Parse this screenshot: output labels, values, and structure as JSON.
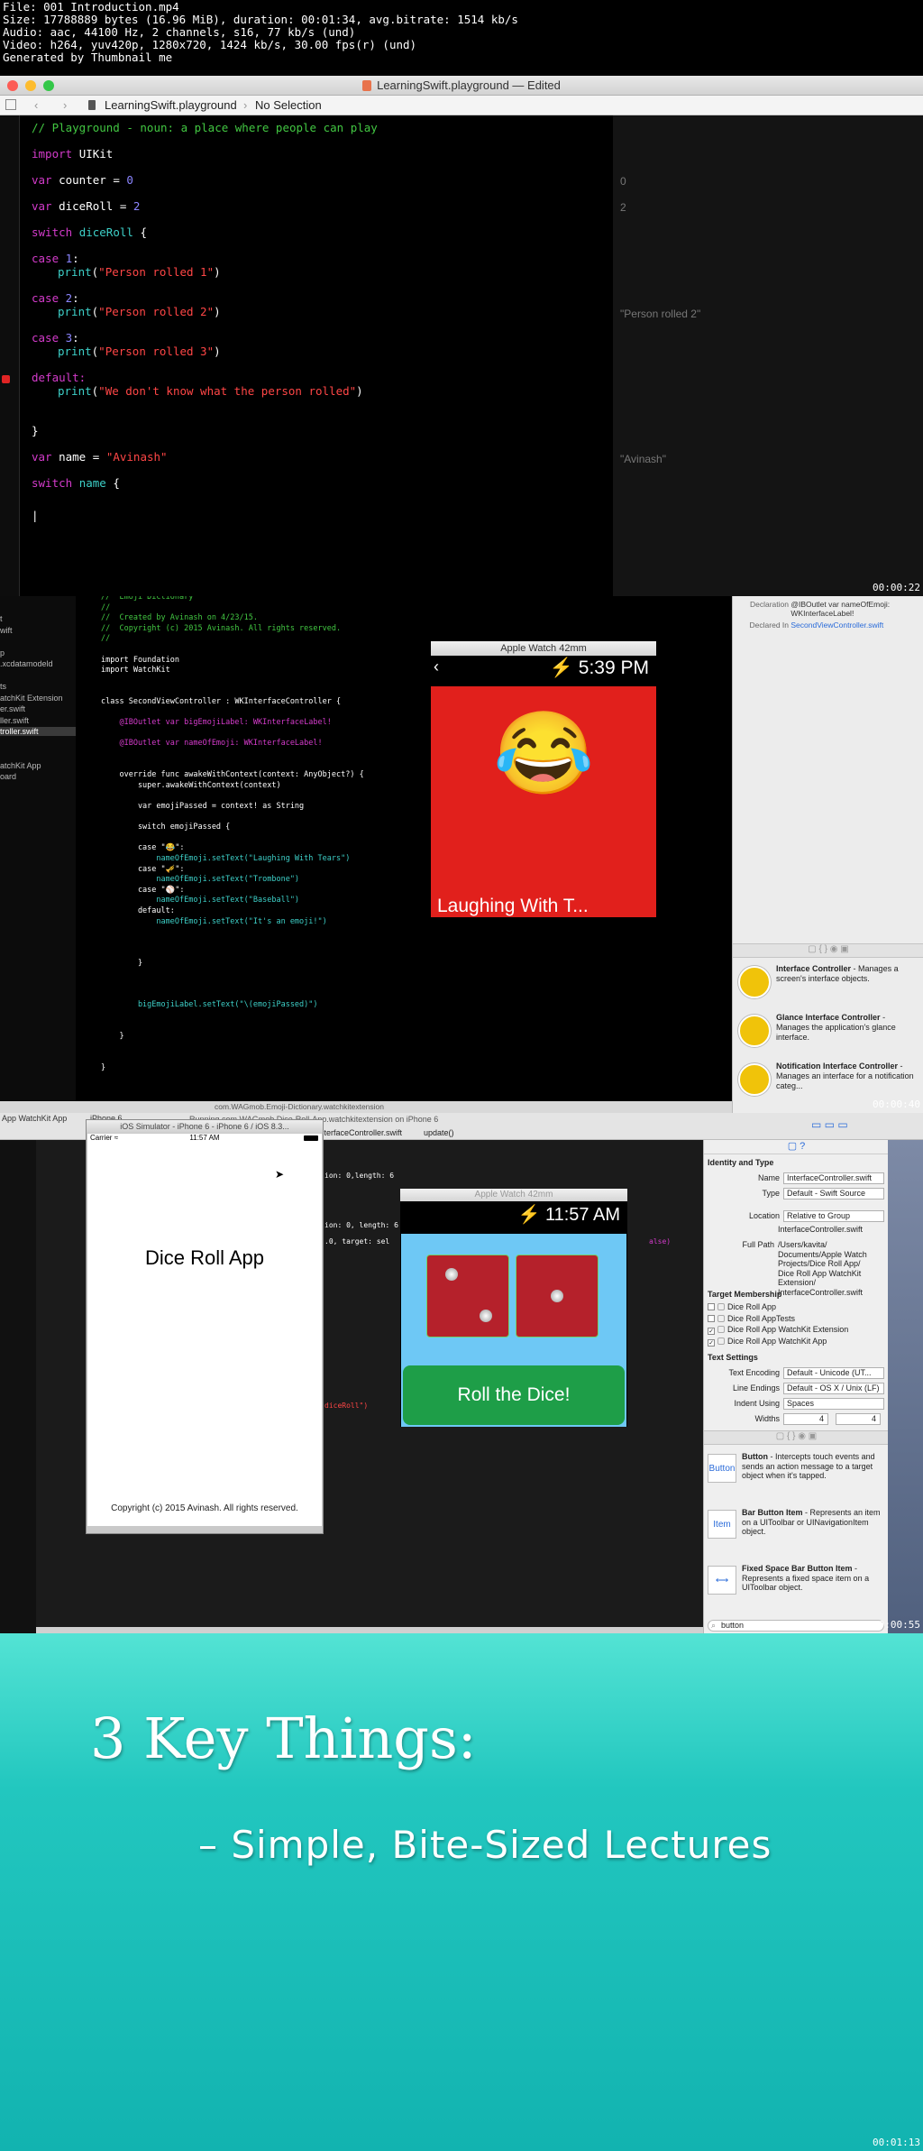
{
  "file_info": [
    "File: 001 Introduction.mp4",
    "Size: 17788889 bytes (16.96 MiB), duration: 00:01:34, avg.bitrate: 1514 kb/s",
    "Audio: aac, 44100 Hz, 2 channels, s16, 77 kb/s (und)",
    "Video: h264, yuv420p, 1280x720, 1424 kb/s, 30.00 fps(r) (und)",
    "Generated by Thumbnail me"
  ],
  "frame1": {
    "window_title": "LearningSwift.playground — Edited",
    "breadcrumb_file": "LearningSwift.playground",
    "breadcrumb_selection": "No Selection",
    "timestamp": "00:00:22",
    "code": {
      "comment": "// Playground - noun: a place where people can play",
      "import_kw": "import",
      "import_mod": "UIKit",
      "var_kw": "var",
      "counter": "counter",
      "counter_val": "0",
      "diceroll": "diceRoll",
      "diceroll_val": "2",
      "switch_kw": "switch",
      "case_kw": "case",
      "case1": "1",
      "case2": "2",
      "case3": "3",
      "print_fn": "print",
      "p1": "\"Person rolled 1\"",
      "p2": "\"Person rolled 2\"",
      "p3": "\"Person rolled 3\"",
      "default_kw": "default:",
      "p4": "\"We don't know what the person rolled\"",
      "name": "name",
      "name_val": "\"Avinash\"",
      "brace_open": "{",
      "brace_close": "}",
      "eq": "=",
      "colon": ":"
    },
    "results": {
      "counter": "0",
      "diceroll": "2",
      "printed": "\"Person rolled 2\"",
      "name": "\"Avinash\""
    }
  },
  "frame2": {
    "timestamp": "00:00:40",
    "watch_title": "Apple Watch 42mm",
    "watch_time": "5:39 PM",
    "emoji": "😂",
    "emoji_label": "Laughing With T...",
    "nav_items": [
      "t",
      "wift",
      "",
      "p",
      ".xcdatamodeld",
      "",
      "ts",
      "atchKit Extension",
      "er.swift",
      "ller.swift",
      "troller.swift",
      "",
      "",
      "atchKit App",
      "oard"
    ],
    "code_lines": [
      "//  Emoji Dictionary",
      "//",
      "//  Created by Avinash on 4/23/15.",
      "//  Copyright (c) 2015 Avinash. All rights reserved.",
      "//",
      "",
      "import Foundation",
      "import WatchKit",
      "",
      "",
      "class SecondViewController : WKInterfaceController {",
      "",
      "    @IBOutlet var bigEmojiLabel: WKInterfaceLabel!",
      "",
      "    @IBOutlet var nameOfEmoji: WKInterfaceLabel!",
      "",
      "",
      "    override func awakeWithContext(context: AnyObject?) {",
      "        super.awakeWithContext(context)",
      "",
      "        var emojiPassed = context! as String",
      "",
      "        switch emojiPassed {",
      "",
      "        case \"😂\":",
      "            nameOfEmoji.setText(\"Laughing With Tears\")",
      "        case \"🎺\":",
      "            nameOfEmoji.setText(\"Trombone\")",
      "        case \"⚾\":",
      "            nameOfEmoji.setText(\"Baseball\")",
      "        default:",
      "            nameOfEmoji.setText(\"It's an emoji!\")",
      "",
      "",
      "",
      "        }",
      "",
      "",
      "",
      "        bigEmojiLabel.setText(\"\\(emojiPassed)\")",
      "",
      "",
      "    }",
      "",
      "",
      "}"
    ],
    "inspector": {
      "declaration_label": "Declaration",
      "declaration_value": "@IBOutlet var nameOfEmoji: WKInterfaceLabel!",
      "declared_label": "Declared In",
      "declared_value": "SecondViewController.swift"
    },
    "library": [
      {
        "title": "Interface Controller",
        "desc": "- Manages a screen's interface objects."
      },
      {
        "title": "Glance Interface Controller",
        "desc": "- Manages the application's glance interface."
      },
      {
        "title": "Notification Interface Controller",
        "desc": "- Manages an interface for a notification categ..."
      }
    ],
    "status_text": "com.WAGmob.Emoji-Dictionary.watchkitextension"
  },
  "frame3": {
    "timestamp": "00:00:55",
    "simulator_title": "iOS Simulator - iPhone 6 - iPhone 6 / iOS 8.3...",
    "carrier": "Carrier",
    "phone_time": "11:57 AM",
    "app_title": "Dice Roll App",
    "copyright": "Copyright (c) 2015 Avinash. All rights reserved.",
    "breadcrumb": "InterfaceController.swift",
    "breadcrumb_method": "update()",
    "run_status": "Running com.WAGmob.Dice-Roll-App.watchkitextension on iPhone 6",
    "scheme": "App WatchKit App",
    "device": "iPhone 6",
    "watch_title": "Apple Watch 42mm",
    "watch_time": "11:57 AM",
    "roll_button": "Roll the Dice!",
    "code_fragments": [
      "ion: 0,length: 6",
      "ion: 0, length: 6",
      ".0, target: sel",
      "alse)",
      "diceRoll\")"
    ],
    "status_text": "com.WAGmob.Dice-Roll-App.watchkitextension",
    "inspector": {
      "identity_header": "Identity and Type",
      "name_label": "Name",
      "name_value": "InterfaceController.swift",
      "type_label": "Type",
      "type_value": "Default - Swift Source",
      "location_label": "Location",
      "location_value": "Relative to Group",
      "location_file": "InterfaceController.swift",
      "fullpath_label": "Full Path",
      "fullpath_value": "/Users/kavita/ Documents/Apple Watch Projects/Dice Roll App/ Dice Roll App WatchKit Extension/ InterfaceController.swift",
      "target_header": "Target Membership",
      "targets": [
        "Dice Roll App",
        "Dice Roll AppTests",
        "Dice Roll App WatchKit Extension",
        "Dice Roll App WatchKit App"
      ],
      "settings_header": "Text Settings",
      "encoding_label": "Text Encoding",
      "encoding_value": "Default - Unicode (UT...",
      "endings_label": "Line Endings",
      "endings_value": "Default - OS X / Unix (LF)",
      "indent_label": "Indent Using",
      "indent_value": "Spaces",
      "widths_label": "Widths",
      "widths_a": "4",
      "widths_b": "4",
      "library": [
        {
          "icon": "Button",
          "title": "Button",
          "desc": "- Intercepts touch events and sends an action message to a target object when it's tapped."
        },
        {
          "icon": "Item",
          "title": "Bar Button Item",
          "desc": "- Represents an item on a UIToolbar or UINavigationItem object."
        },
        {
          "icon": "",
          "title": "Fixed Space Bar Button Item",
          "desc": "- Represents a fixed space item on a UIToolbar object."
        }
      ],
      "search_text": "button"
    }
  },
  "frame4": {
    "timestamp": "00:01:13",
    "title": "3 Key Things:",
    "bullet": "– Simple, Bite-Sized Lectures"
  }
}
